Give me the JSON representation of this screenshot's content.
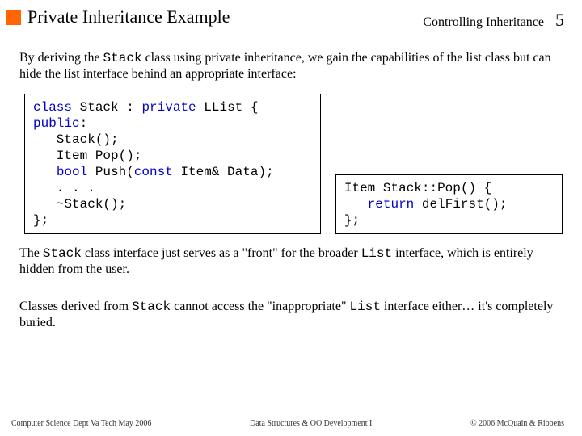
{
  "header": {
    "title": "Private Inheritance Example",
    "section": "Controlling Inheritance",
    "page": "5"
  },
  "intro": {
    "a": "By deriving the ",
    "cls": "Stack",
    "b": " class using private inheritance, we gain the capabilities of the list class but can hide the list interface behind an appropriate interface:"
  },
  "code1": {
    "l1a": "class",
    "l1b": " Stack : ",
    "l1c": "private",
    "l1d": " LList {",
    "l2": "public",
    "l2b": ":",
    "l3": "   Stack();",
    "l4": "   Item Pop();",
    "l5a": "   ",
    "l5b": "bool",
    "l5c": " Push(",
    "l5d": "const",
    "l5e": " Item& Data);",
    "l6": "   . . .",
    "l7": "   ~Stack();",
    "l8": "};"
  },
  "code2": {
    "l1": "Item Stack::Pop() {",
    "l2a": "   ",
    "l2b": "return",
    "l2c": " delFirst();",
    "l3": "};"
  },
  "p2": {
    "a": "The ",
    "cls1": "Stack",
    "b": " class interface just serves as a \"front\" for the broader ",
    "cls2": "List",
    "c": " interface, which is entirely hidden from the user."
  },
  "p3": {
    "a": "Classes derived from ",
    "cls1": "Stack",
    "b": " cannot access the \"inappropriate\" ",
    "cls2": "List",
    "c": " interface either… it's completely buried."
  },
  "footer": {
    "left": "Computer Science Dept Va Tech May 2006",
    "mid": "Data Structures & OO Development I",
    "right": "© 2006  McQuain & Ribbens"
  }
}
